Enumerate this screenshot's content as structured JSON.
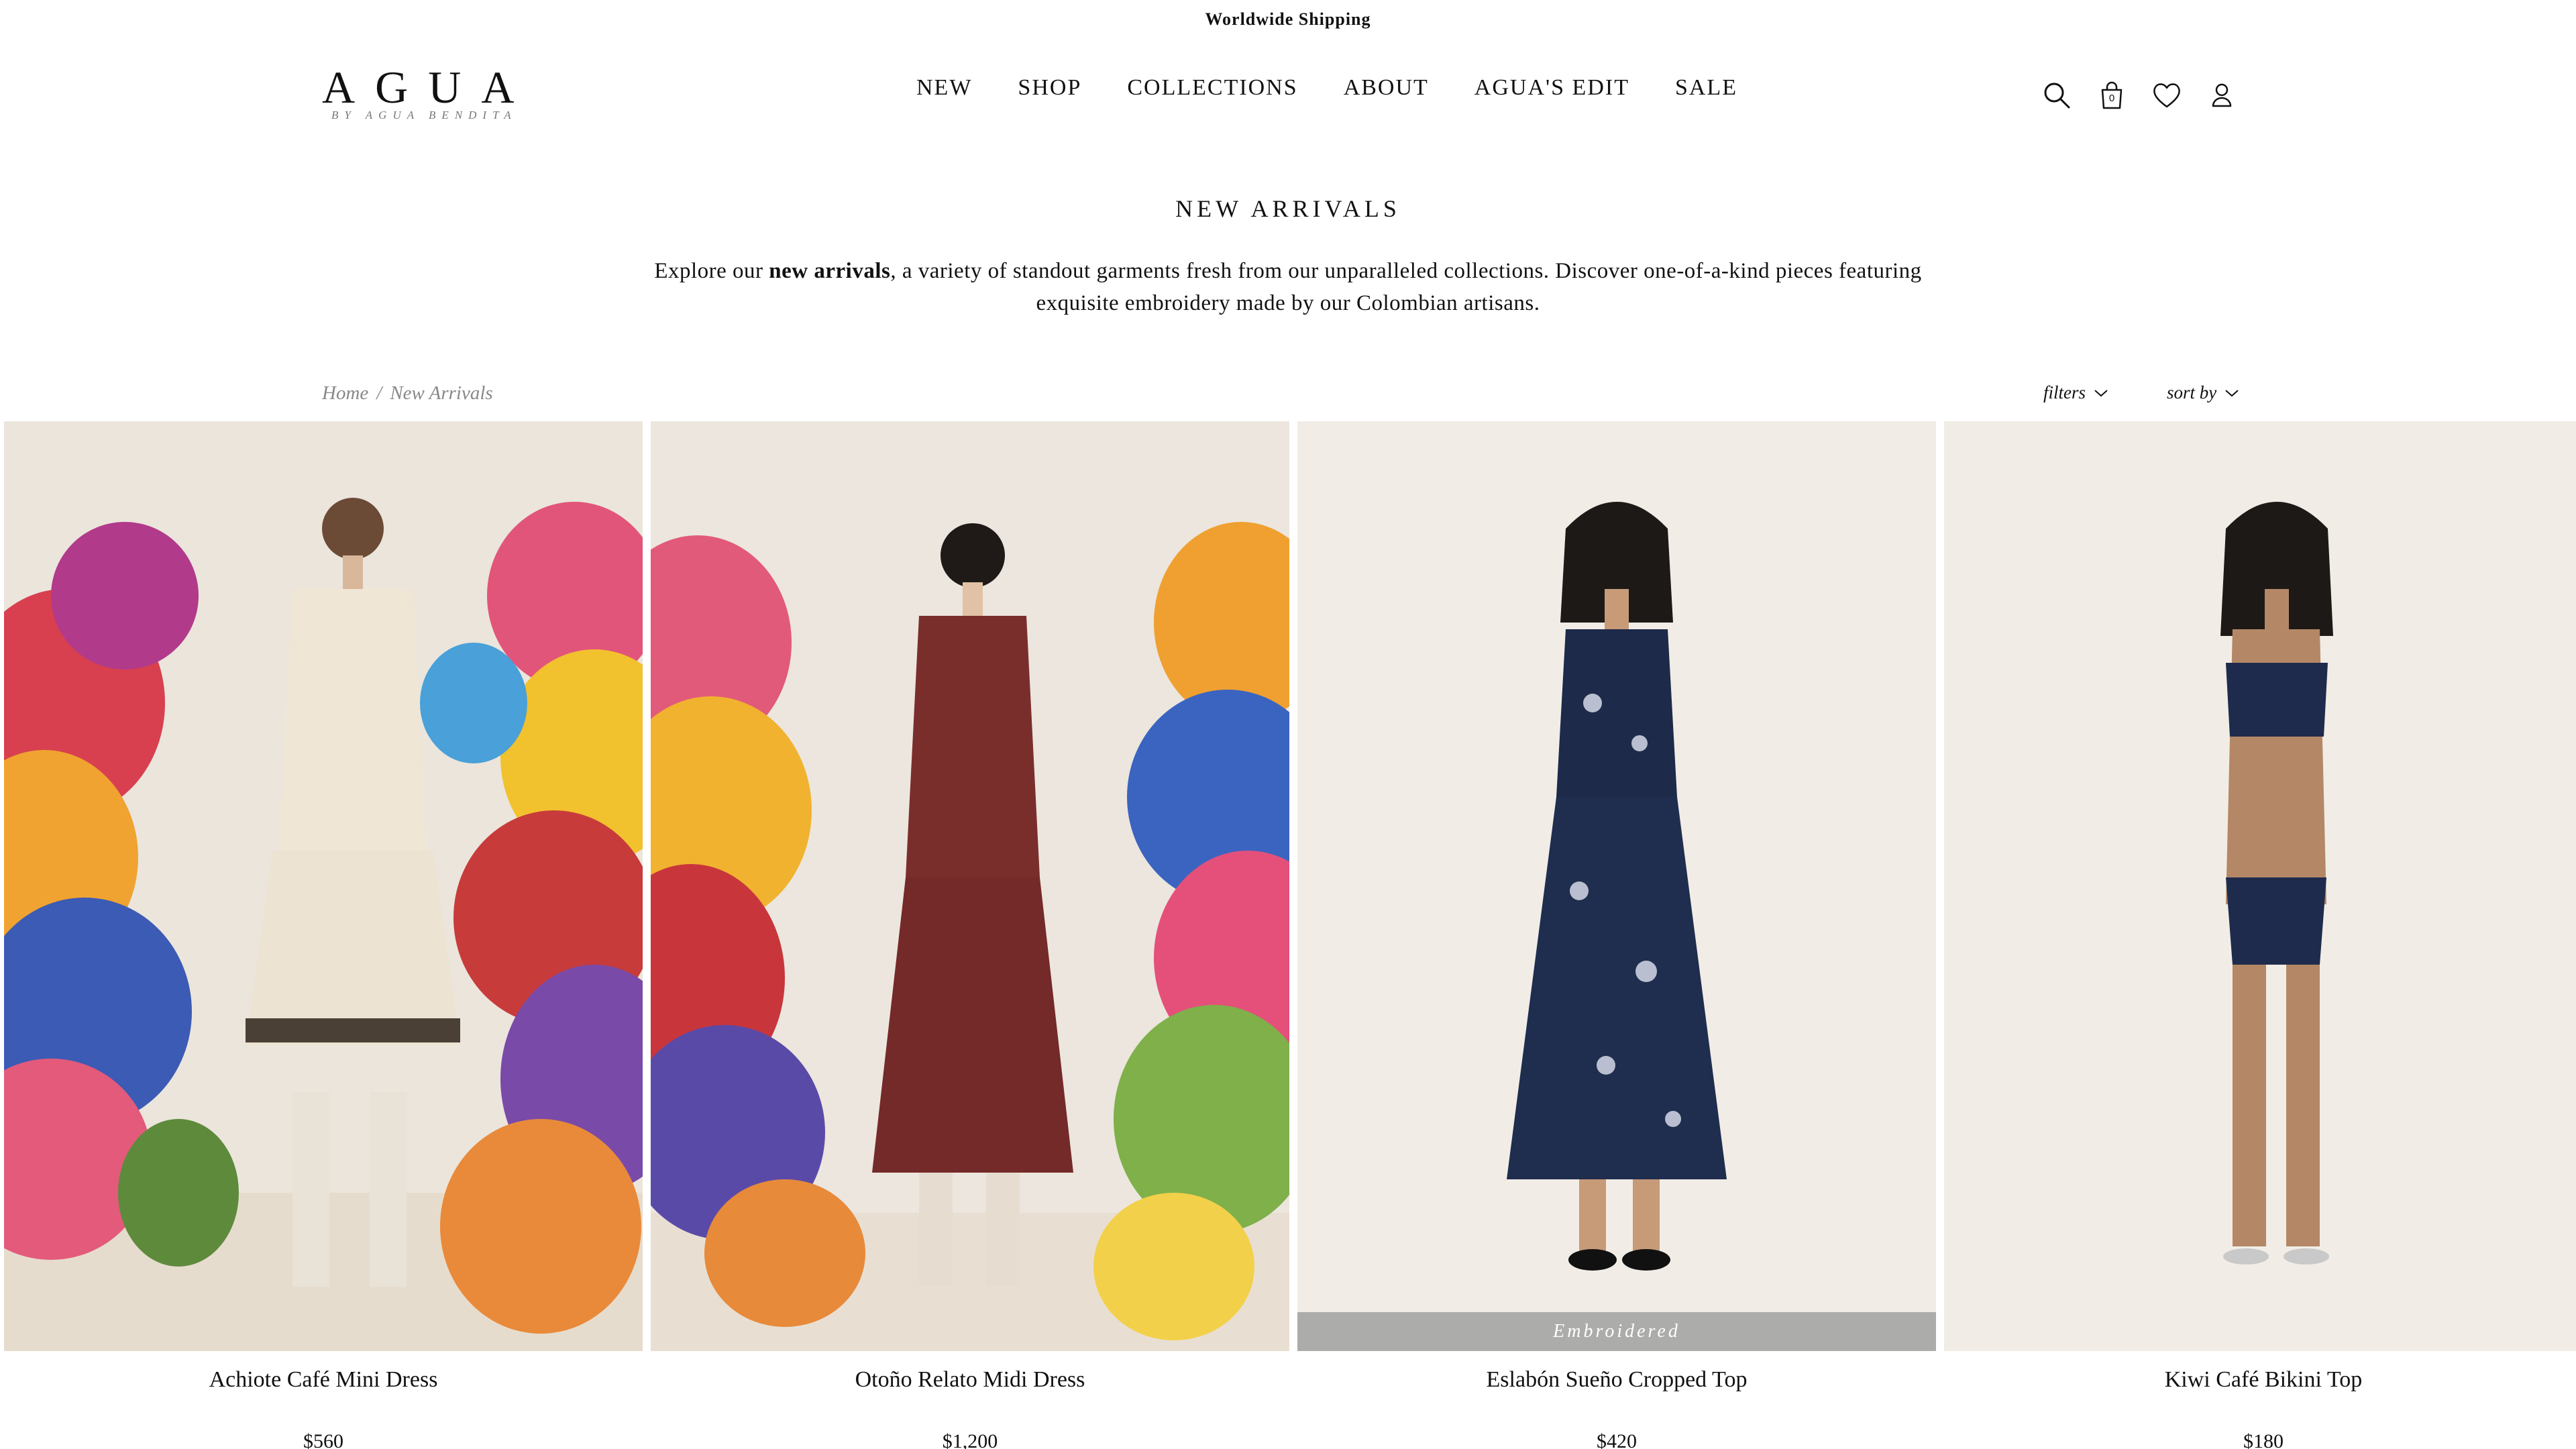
{
  "announcement": "Worldwide Shipping",
  "brand": {
    "name": "AGUA",
    "tagline": "BY AGUA BENDITA"
  },
  "nav": [
    "NEW",
    "SHOP",
    "COLLECTIONS",
    "ABOUT",
    "AGUA'S EDIT",
    "SALE"
  ],
  "icons": {
    "search": "search-icon",
    "bag": "shopping-bag-icon",
    "wishlist": "heart-icon",
    "account": "user-icon",
    "bag_count": "0"
  },
  "intro": {
    "title": "NEW ARRIVALS",
    "desc_prefix": "Explore our ",
    "desc_bold": "new arrivals",
    "desc_suffix": ", a variety of standout garments fresh from our unparalleled collections. Discover one-of-a-kind pieces featuring exquisite embroidery made by our Colombian artisans."
  },
  "breadcrumb": {
    "home": "Home",
    "separator": "/",
    "current": "New Arrivals"
  },
  "controls": {
    "filters": "filters",
    "sort": "sort by"
  },
  "colors": {
    "text": "#111111",
    "muted": "#888888",
    "badge": "#a0a0a0"
  },
  "products": [
    {
      "name": "Achiote Café Mini Dress",
      "price": "$560",
      "badge": ""
    },
    {
      "name": "Otoño Relato Midi Dress",
      "price": "$1,200",
      "badge": ""
    },
    {
      "name": "Eslabón Sueño Cropped Top",
      "price": "$420",
      "badge": "Embroidered"
    },
    {
      "name": "Kiwi Café Bikini Top",
      "price": "$180",
      "badge": ""
    }
  ]
}
